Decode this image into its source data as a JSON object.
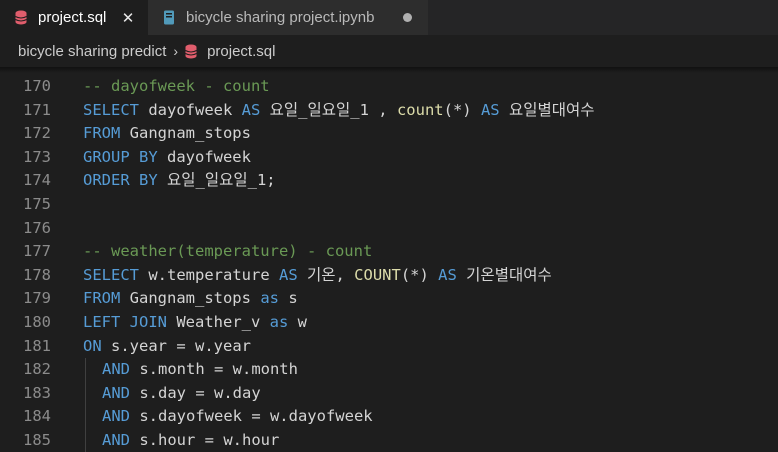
{
  "tabs": [
    {
      "label": "project.sql",
      "active": true,
      "close": "✕",
      "icon": "database-icon"
    },
    {
      "label": "bicycle sharing project.ipynb",
      "active": false,
      "icon": "notebook-icon"
    }
  ],
  "breadcrumb": {
    "folder": "bicycle sharing predict",
    "separator": "›",
    "file": "project.sql"
  },
  "colors": {
    "keyword": "#569cd6",
    "comment": "#6a9955",
    "function": "#dcdcaa",
    "text": "#d4d4d4",
    "line_number": "#8b8b8b",
    "sql_icon": "#e05d6c"
  },
  "lines": [
    {
      "num": "170",
      "tokens": [
        {
          "cls": "c",
          "text": "-- dayofweek - count"
        }
      ]
    },
    {
      "num": "171",
      "tokens": [
        {
          "cls": "k",
          "text": "SELECT"
        },
        {
          "cls": "t",
          "text": " dayofweek "
        },
        {
          "cls": "k",
          "text": "AS"
        },
        {
          "cls": "t",
          "text": " 요일_일요일_1 , "
        },
        {
          "cls": "f",
          "text": "count"
        },
        {
          "cls": "t",
          "text": "(*) "
        },
        {
          "cls": "k",
          "text": "AS"
        },
        {
          "cls": "t",
          "text": " 요일별대여수"
        }
      ]
    },
    {
      "num": "172",
      "tokens": [
        {
          "cls": "k",
          "text": "FROM"
        },
        {
          "cls": "t",
          "text": " Gangnam_stops"
        }
      ]
    },
    {
      "num": "173",
      "tokens": [
        {
          "cls": "k",
          "text": "GROUP BY"
        },
        {
          "cls": "t",
          "text": " dayofweek"
        }
      ]
    },
    {
      "num": "174",
      "tokens": [
        {
          "cls": "k",
          "text": "ORDER BY"
        },
        {
          "cls": "t",
          "text": " 요일_일요일_1;"
        }
      ]
    },
    {
      "num": "175",
      "tokens": []
    },
    {
      "num": "176",
      "tokens": []
    },
    {
      "num": "177",
      "tokens": [
        {
          "cls": "c",
          "text": "-- weather(temperature) - count"
        }
      ]
    },
    {
      "num": "178",
      "tokens": [
        {
          "cls": "k",
          "text": "SELECT"
        },
        {
          "cls": "t",
          "text": " w.temperature "
        },
        {
          "cls": "k",
          "text": "AS"
        },
        {
          "cls": "t",
          "text": " 기온, "
        },
        {
          "cls": "f",
          "text": "COUNT"
        },
        {
          "cls": "t",
          "text": "(*) "
        },
        {
          "cls": "k",
          "text": "AS"
        },
        {
          "cls": "t",
          "text": " 기온별대여수"
        }
      ]
    },
    {
      "num": "179",
      "tokens": [
        {
          "cls": "k",
          "text": "FROM"
        },
        {
          "cls": "t",
          "text": " Gangnam_stops "
        },
        {
          "cls": "k",
          "text": "as"
        },
        {
          "cls": "t",
          "text": " s"
        }
      ]
    },
    {
      "num": "180",
      "tokens": [
        {
          "cls": "k",
          "text": "LEFT JOIN"
        },
        {
          "cls": "t",
          "text": " Weather_v "
        },
        {
          "cls": "k",
          "text": "as"
        },
        {
          "cls": "t",
          "text": " w"
        }
      ]
    },
    {
      "num": "181",
      "tokens": [
        {
          "cls": "k",
          "text": "ON"
        },
        {
          "cls": "t",
          "text": " s.year = w.year"
        }
      ]
    },
    {
      "num": "182",
      "indent": true,
      "tokens": [
        {
          "cls": "k",
          "text": "AND"
        },
        {
          "cls": "t",
          "text": " s.month = w.month"
        }
      ]
    },
    {
      "num": "183",
      "indent": true,
      "tokens": [
        {
          "cls": "k",
          "text": "AND"
        },
        {
          "cls": "t",
          "text": " s.day = w.day"
        }
      ]
    },
    {
      "num": "184",
      "indent": true,
      "tokens": [
        {
          "cls": "k",
          "text": "AND"
        },
        {
          "cls": "t",
          "text": " s.dayofweek = w.dayofweek"
        }
      ]
    },
    {
      "num": "185",
      "indent": true,
      "tokens": [
        {
          "cls": "k",
          "text": "AND"
        },
        {
          "cls": "t",
          "text": " s.hour = w.hour"
        }
      ]
    }
  ]
}
